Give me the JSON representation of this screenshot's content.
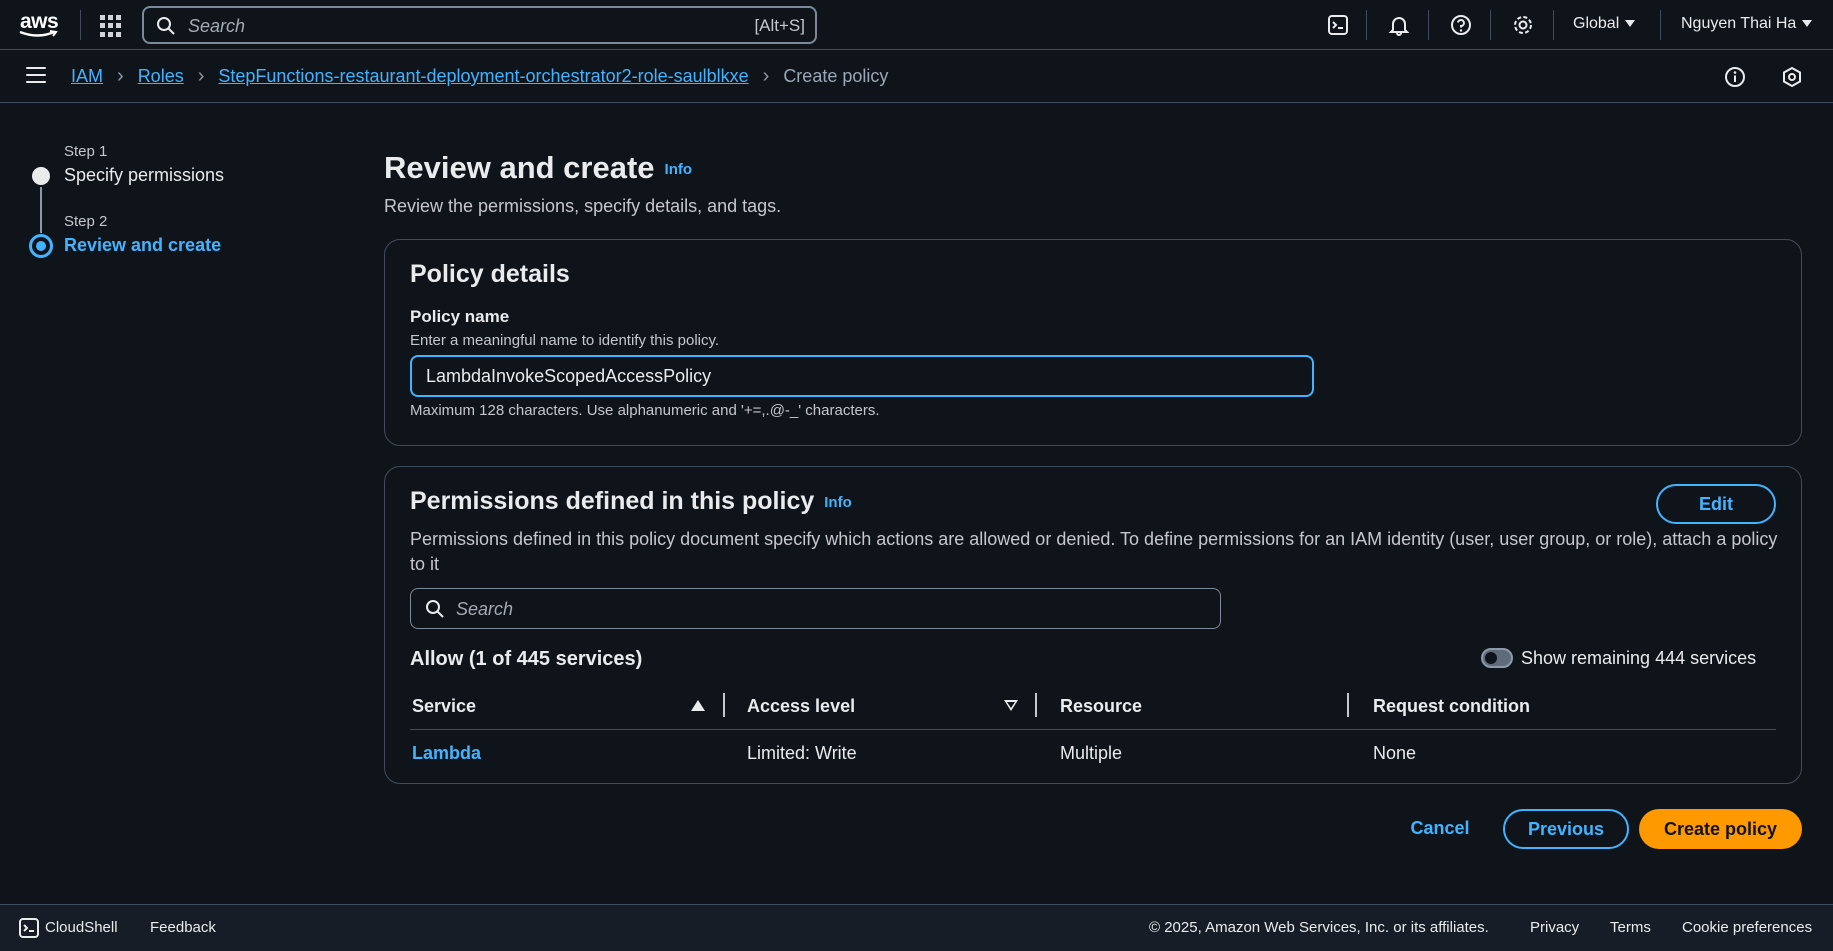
{
  "topnav": {
    "logo_text": "aws",
    "search_placeholder": "Search",
    "search_shortcut": "[Alt+S]",
    "region": "Global",
    "user": "Nguyen Thai Ha"
  },
  "breadcrumb": {
    "items": [
      "IAM",
      "Roles",
      "StepFunctions-restaurant-deployment-orchestrator2-role-saulblkxe"
    ],
    "current": "Create policy"
  },
  "steps": [
    {
      "step_label": "Step 1",
      "name": "Specify permissions",
      "active": false
    },
    {
      "step_label": "Step 2",
      "name": "Review and create",
      "active": true
    }
  ],
  "page": {
    "title": "Review and create",
    "info": "Info",
    "subtitle": "Review the permissions, specify details, and tags."
  },
  "policy_details": {
    "heading": "Policy details",
    "name_label": "Policy name",
    "name_description": "Enter a meaningful name to identify this policy.",
    "name_value": "LambdaInvokeScopedAccessPolicy",
    "name_hint": "Maximum 128 characters. Use alphanumeric and '+=,.@-_' characters."
  },
  "permissions": {
    "heading": "Permissions defined in this policy",
    "info": "Info",
    "edit_label": "Edit",
    "description": "Permissions defined in this policy document specify which actions are allowed or denied. To define permissions for an IAM identity (user, user group, or role), attach a policy to it",
    "search_placeholder": "Search",
    "allow_heading": "Allow (1 of 445 services)",
    "toggle_label": "Show remaining 444 services",
    "columns": [
      "Service",
      "Access level",
      "Resource",
      "Request condition"
    ],
    "rows": [
      {
        "service": "Lambda",
        "access_level": "Limited: Write",
        "resource": "Multiple",
        "request_condition": "None"
      }
    ]
  },
  "actions": {
    "cancel": "Cancel",
    "previous": "Previous",
    "create": "Create policy"
  },
  "footer": {
    "cloudshell": "CloudShell",
    "feedback": "Feedback",
    "copyright": "© 2025, Amazon Web Services, Inc. or its affiliates.",
    "privacy": "Privacy",
    "terms": "Terms",
    "cookies": "Cookie preferences"
  },
  "colors": {
    "accent": "#42b4ff",
    "primary_button": "#ff9900",
    "background": "#0f141a",
    "border": "#414d5c"
  }
}
